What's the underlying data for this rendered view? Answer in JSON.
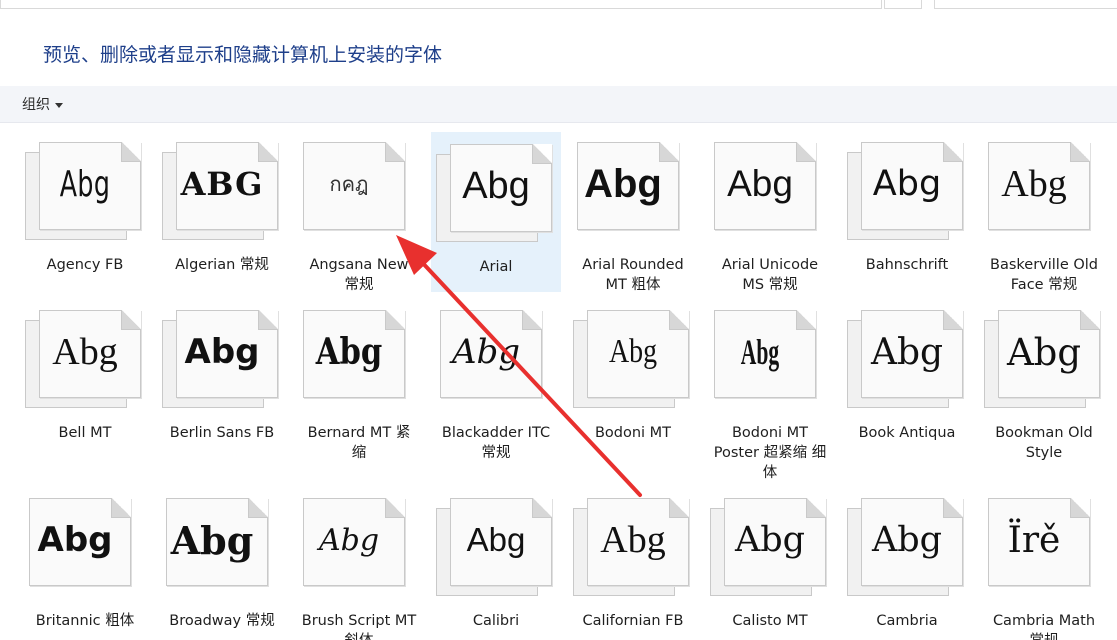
{
  "header": {
    "title": "预览、删除或者显示和隐藏计算机上安装的字体"
  },
  "toolbar": {
    "organize_label": "组织",
    "organize_icon": "chevron-down-icon"
  },
  "fonts": [
    {
      "label": "Agency FB",
      "sample": "Abg"
    },
    {
      "label": "Algerian 常规",
      "sample": "ABG"
    },
    {
      "label": "Angsana New 常规",
      "sample": "กคฎ"
    },
    {
      "label": "Arial",
      "sample": "Abg",
      "selected": true
    },
    {
      "label": "Arial Rounded MT 粗体",
      "sample": "Abg"
    },
    {
      "label": "Arial Unicode MS 常规",
      "sample": "Abg"
    },
    {
      "label": "Bahnschrift",
      "sample": "Abg"
    },
    {
      "label": "Baskerville Old Face 常规",
      "sample": "Abg"
    },
    {
      "label": "Bell MT",
      "sample": "Abg"
    },
    {
      "label": "Berlin Sans FB",
      "sample": "Abg"
    },
    {
      "label": "Bernard MT 紧缩",
      "sample": "Abg"
    },
    {
      "label": "Blackadder ITC 常规",
      "sample": "Abg"
    },
    {
      "label": "Bodoni MT",
      "sample": "Abg"
    },
    {
      "label": "Bodoni MT Poster 超紧缩 细体",
      "sample": "Abg"
    },
    {
      "label": "Book Antiqua",
      "sample": "Abg"
    },
    {
      "label": "Bookman Old Style",
      "sample": "Abg"
    },
    {
      "label": "Britannic 粗体",
      "sample": "Abg"
    },
    {
      "label": "Broadway 常规",
      "sample": "Abg"
    },
    {
      "label": "Brush Script MT 斜体",
      "sample": "Abg"
    },
    {
      "label": "Calibri",
      "sample": "Abg"
    },
    {
      "label": "Californian FB",
      "sample": "Abg"
    },
    {
      "label": "Calisto MT",
      "sample": "Abg"
    },
    {
      "label": "Cambria",
      "sample": "Abg"
    },
    {
      "label": "Cambria Math 常规",
      "sample": "Ïrě"
    }
  ],
  "colors": {
    "title": "#1e3f8a",
    "toolbar_bg": "#f3f5f9",
    "selection_bg": "#e5f1fb",
    "annotation_arrow": "#e8302e"
  }
}
